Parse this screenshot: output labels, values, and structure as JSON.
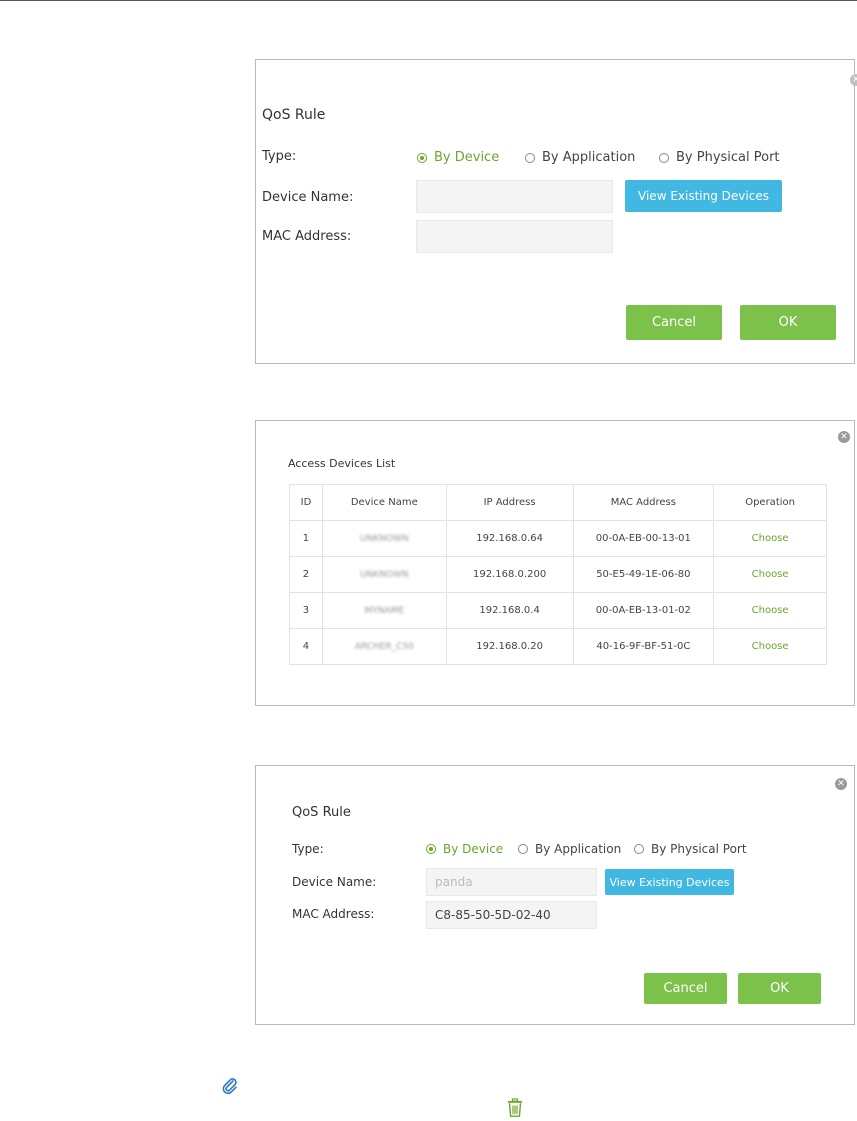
{
  "panel1": {
    "title": "QoS Rule",
    "type_label": "Type:",
    "radio_by_device": "By Device",
    "radio_by_application": "By Application",
    "radio_by_physical_port": "By Physical Port",
    "device_name_label": "Device Name:",
    "device_name_value": "",
    "mac_label": "MAC Address:",
    "mac_value": "",
    "view_devices_label": "View Existing Devices",
    "cancel_label": "Cancel",
    "ok_label": "OK"
  },
  "panel2": {
    "title": "Access Devices List",
    "columns": [
      "ID",
      "Device Name",
      "IP Address",
      "MAC Address",
      "Operation"
    ],
    "rows": [
      {
        "id": "1",
        "name": "UNKNOWN",
        "ip": "192.168.0.64",
        "mac": "00-0A-EB-00-13-01",
        "op": "Choose"
      },
      {
        "id": "2",
        "name": "UNKNOWN",
        "ip": "192.168.0.200",
        "mac": "50-E5-49-1E-06-80",
        "op": "Choose"
      },
      {
        "id": "3",
        "name": "MYNAME",
        "ip": "192.168.0.4",
        "mac": "00-0A-EB-13-01-02",
        "op": "Choose"
      },
      {
        "id": "4",
        "name": "ARCHER_C50",
        "ip": "192.168.0.20",
        "mac": "40-16-9F-BF-51-0C",
        "op": "Choose"
      }
    ]
  },
  "panel3": {
    "title": "QoS Rule",
    "type_label": "Type:",
    "radio_by_device": "By Device",
    "radio_by_application": "By Application",
    "radio_by_physical_port": "By Physical Port",
    "device_name_label": "Device Name:",
    "device_name_value": "panda",
    "mac_label": "MAC Address:",
    "mac_value": "C8-85-50-5D-02-40",
    "view_devices_label": "View Existing Devices",
    "cancel_label": "Cancel",
    "ok_label": "OK"
  },
  "icons": {
    "close": "close-icon",
    "attachment": "paperclip-icon",
    "delete": "trash-icon"
  },
  "colors": {
    "accent_green": "#6aa72c",
    "button_green": "#7cc14a",
    "button_blue": "#41b8e1"
  }
}
